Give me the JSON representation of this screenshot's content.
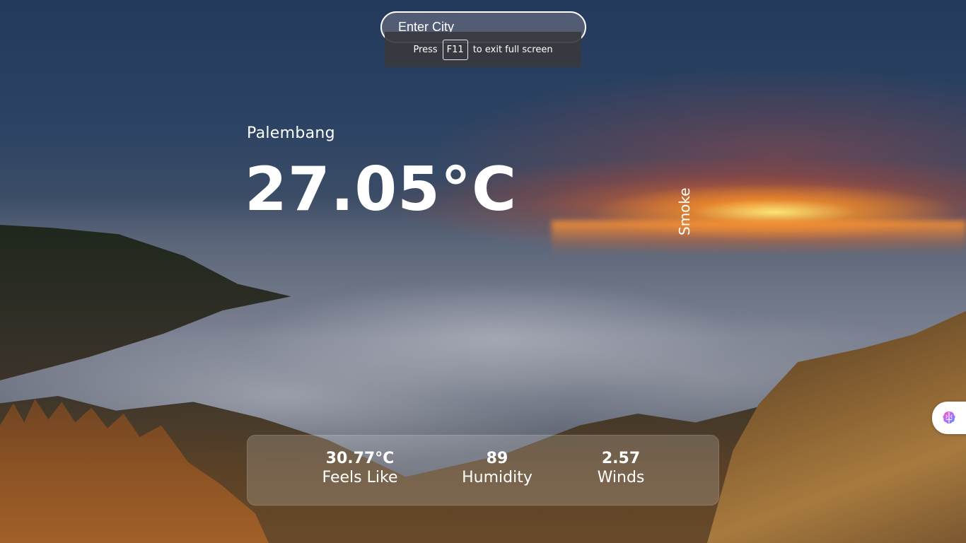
{
  "search": {
    "placeholder": "Enter City"
  },
  "fullscreen_notice": {
    "prefix": "Press",
    "key": "F11",
    "suffix": "to exit full screen"
  },
  "weather": {
    "city": "Palembang",
    "temperature": "27.05°C",
    "condition": "Smoke"
  },
  "stats": {
    "feels_like": {
      "value": "30.77°C",
      "label": "Feels Like"
    },
    "humidity": {
      "value": "89",
      "label": "Humidity"
    },
    "winds": {
      "value": "2.57",
      "label": "Winds"
    }
  },
  "extension": {
    "icon": "brain-icon"
  },
  "colors": {
    "text": "#ffffff",
    "panel": "rgba(255,255,255,0.18)",
    "toast_bg": "#37393e"
  }
}
